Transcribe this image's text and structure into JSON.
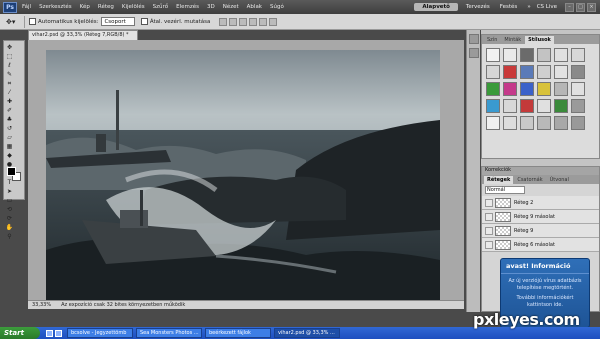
{
  "app": {
    "logo": "Ps",
    "menu": [
      "Fájl",
      "Szerkesztés",
      "Kép",
      "Réteg",
      "Kijelölés",
      "Szűrő",
      "Elemzés",
      "3D",
      "Nézet",
      "Ablak",
      "Súgó"
    ],
    "workspaces": {
      "active": "Alapvető",
      "items": [
        "Tervezés",
        "Festés"
      ],
      "more": "»",
      "cslive": "CS Live"
    }
  },
  "options_bar": {
    "auto_select_label": "Automatikus kijelölés:",
    "auto_select_value": "Csoport",
    "show_transform_label": "Átal. vezérl. mutatása"
  },
  "document": {
    "tab_title": "vihar2.psd @ 33,3% (Réteg 7,RGB/8) *",
    "status_zoom": "33,33%",
    "status_text": "Az expozíció csak 32 bites környezetben működik"
  },
  "styles_panel": {
    "tabs": [
      "Szín",
      "Minták",
      "Stílusok"
    ],
    "swatches": [
      "#f2f2f2",
      "#e9e9e9",
      "#6b6b6b",
      "#c3c3c3",
      "#e0e0e0",
      "#d8d8d8",
      "#d6d6d6",
      "#c83a3a",
      "#5a7ab8",
      "#cfcfcf",
      "#e2e2e2",
      "#8a8a8a",
      "#3a9a3a",
      "#c43a8a",
      "#3b62c9",
      "#d8c23a",
      "#b6b6b6",
      "#e0e0e0",
      "#3a9ad0",
      "#d8d8d8",
      "#c33a3a",
      "#e0e0e0",
      "#3a8a3a",
      "#9a9a9a",
      "#f0f0f0",
      "#dcdcdc",
      "#c9c9c9",
      "#b9b9b9",
      "#a8a8a8",
      "#999999"
    ]
  },
  "layers_panel": {
    "header": "Korrekciók",
    "tabs": [
      "Rétegek",
      "Csatornák",
      "Útvonal"
    ],
    "blend_mode": "Normál",
    "layers": [
      {
        "name": "Réteg 2"
      },
      {
        "name": "Réteg 9 másolat"
      },
      {
        "name": "Réteg 9"
      },
      {
        "name": "Réteg 6 másolat"
      }
    ]
  },
  "avast": {
    "title": "avast! Információ",
    "message": "Az új verziójú vírus adatbázis telepítése megtörtént.",
    "note": "További információkért kattintson ide."
  },
  "taskbar": {
    "start": "Start",
    "tasks": [
      "bcsolve - Jegyzettömb",
      "Sea Monsters Photos ...",
      "beérkezett fájlok",
      "vihar2.psd @ 33,3% ..."
    ]
  },
  "watermark": "pxleyes.com"
}
